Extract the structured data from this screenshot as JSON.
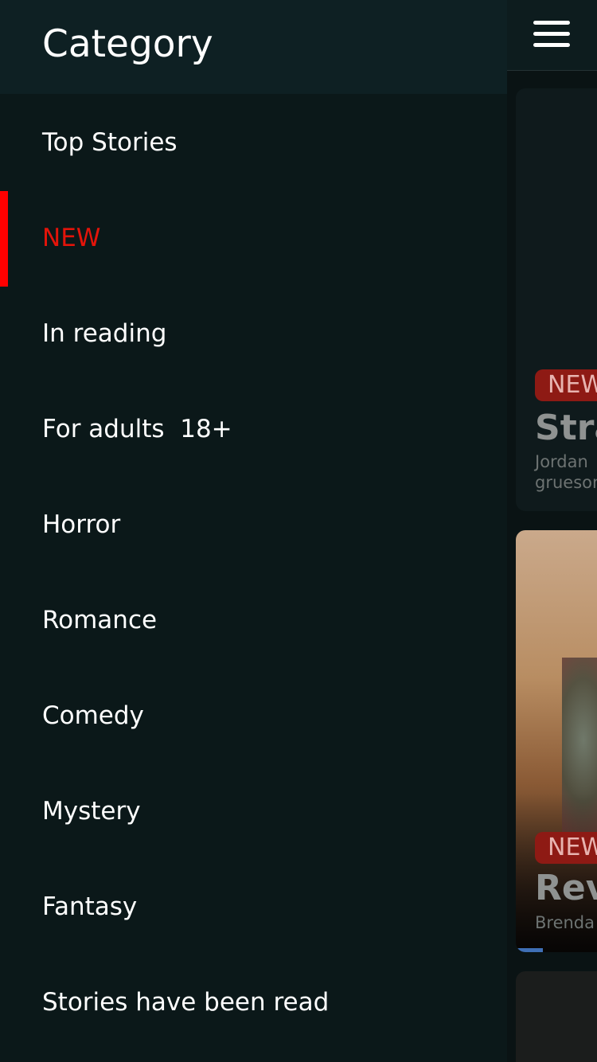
{
  "drawer": {
    "title": "Category",
    "items": [
      {
        "label": "Top Stories",
        "active": false
      },
      {
        "label": "NEW",
        "active": true
      },
      {
        "label": "In reading",
        "active": false
      },
      {
        "label": "For adults  18+",
        "active": false
      },
      {
        "label": "Horror",
        "active": false
      },
      {
        "label": "Romance",
        "active": false
      },
      {
        "label": "Comedy",
        "active": false
      },
      {
        "label": "Mystery",
        "active": false
      },
      {
        "label": "Fantasy",
        "active": false
      },
      {
        "label": "Stories have been read",
        "active": false
      }
    ]
  },
  "background": {
    "menu_icon": "hamburger-icon",
    "cards": [
      {
        "badge": "NEW",
        "title": "Stra",
        "subtitle_line1": "Jordan",
        "subtitle_line2": "grueson"
      },
      {
        "badge": "NEW",
        "title": "Rev",
        "subtitle_line1": "Brenda"
      }
    ]
  },
  "colors": {
    "accent_active": "#ff0000",
    "active_text": "#e3140a",
    "drawer_background": "#0b1819",
    "header_background": "#0e2023",
    "badge_background": "#8e1a14"
  }
}
